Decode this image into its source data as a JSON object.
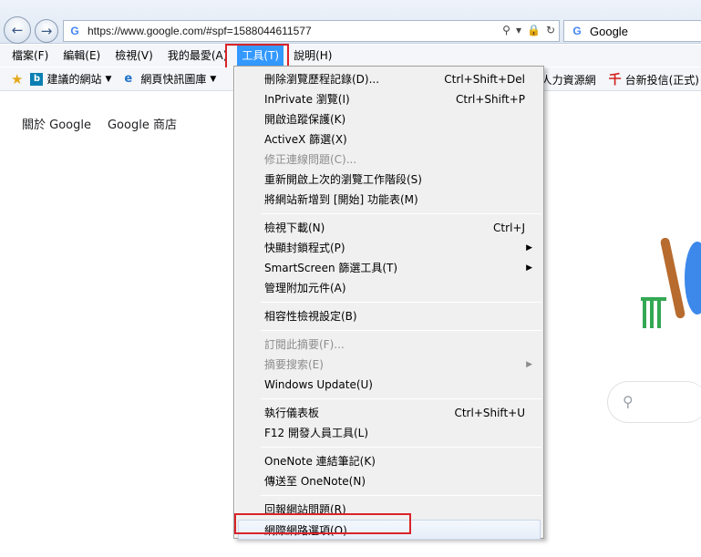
{
  "address_bar": {
    "url": "https://www.google.com/#spf=1588044611577",
    "tab_title": "Google",
    "back_icon": "back-arrow-icon",
    "forward_icon": "forward-arrow-icon"
  },
  "menu_bar": {
    "items": [
      "檔案(F)",
      "編輯(E)",
      "檢視(V)",
      "我的最愛(A)",
      "工具(T)",
      "說明(H)"
    ],
    "active_index": 4
  },
  "favorites_bar": {
    "items": [
      "建議的網站",
      "網頁快訊圖庫"
    ],
    "right_items": [
      "人力資源網",
      "台新投信(正式)"
    ]
  },
  "page": {
    "top_links": [
      "關於 Google",
      "Google 商店"
    ]
  },
  "tools_menu": {
    "groups": [
      [
        {
          "label": "刪除瀏覽歷程記錄(D)...",
          "shortcut": "Ctrl+Shift+Del"
        },
        {
          "label": "InPrivate 瀏覽(I)",
          "shortcut": "Ctrl+Shift+P"
        },
        {
          "label": "開啟追蹤保護(K)"
        },
        {
          "label": "ActiveX 篩選(X)"
        },
        {
          "label": "修正連線問題(C)...",
          "disabled": true
        },
        {
          "label": "重新開啟上次的瀏覽工作階段(S)"
        },
        {
          "label": "將網站新增到 [開始] 功能表(M)"
        }
      ],
      [
        {
          "label": "檢視下載(N)",
          "shortcut": "Ctrl+J"
        },
        {
          "label": "快顯封鎖程式(P)",
          "submenu": true
        },
        {
          "label": "SmartScreen 篩選工具(T)",
          "submenu": true
        },
        {
          "label": "管理附加元件(A)"
        }
      ],
      [
        {
          "label": "相容性檢視設定(B)"
        }
      ],
      [
        {
          "label": "訂閱此摘要(F)...",
          "disabled": true
        },
        {
          "label": "摘要搜索(E)",
          "disabled": true,
          "submenu": true
        },
        {
          "label": "Windows Update(U)"
        }
      ],
      [
        {
          "label": "執行儀表板",
          "shortcut": "Ctrl+Shift+U"
        },
        {
          "label": "F12 開發人員工具(L)"
        }
      ],
      [
        {
          "label": "OneNote 連結筆記(K)"
        },
        {
          "label": "傳送至 OneNote(N)"
        }
      ],
      [
        {
          "label": "回報網站問題(R)"
        },
        {
          "label": "網際網路選項(O)",
          "highlighted": true
        }
      ]
    ]
  }
}
